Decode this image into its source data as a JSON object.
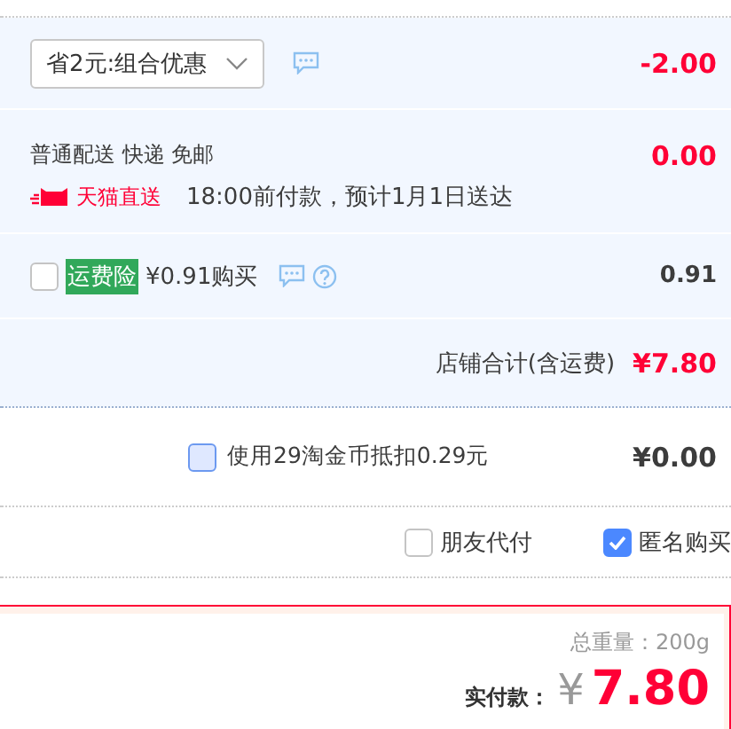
{
  "promotion": {
    "selector": {
      "value": "省2元:组合优惠"
    },
    "amount": "-2.00"
  },
  "delivery": {
    "method": "普通配送 快递 免邮",
    "badge": "天猫直送",
    "note": "18:00前付款，预计1月1日送达",
    "amount": "0.00"
  },
  "insurance": {
    "checked": false,
    "tag": "运费险",
    "price": "¥0.91购买",
    "amount": "0.91"
  },
  "store_total": {
    "label": "店铺合计(含运费)",
    "amount": "¥7.80"
  },
  "coins": {
    "checked": false,
    "label": "使用29淘金币抵扣0.29元",
    "amount": "¥0.00"
  },
  "options": [
    {
      "label": "朋友代付",
      "checked": false
    },
    {
      "label": "匿名购买",
      "checked": true
    }
  ],
  "summary": {
    "weight": "总重量：200g",
    "total_label": "实付款：",
    "currency": "¥",
    "total": "7.80"
  }
}
